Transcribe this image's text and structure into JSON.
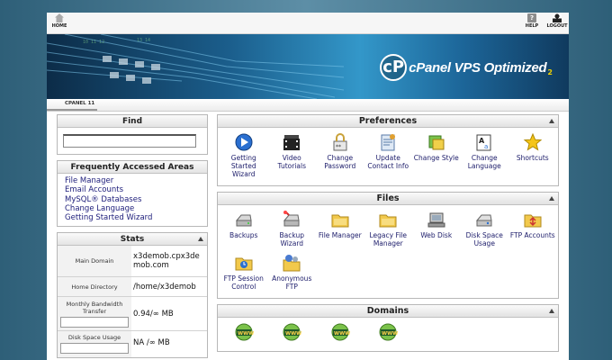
{
  "nav": {
    "home": "HOME",
    "help": "HELP",
    "logout": "LOGOUT"
  },
  "banner": {
    "logo_mark": "cP",
    "logo_text": "cPanel VPS Optimized",
    "logo_suffix": "2"
  },
  "breadcrumb": "CPANEL 11",
  "find": {
    "title": "Find",
    "value": ""
  },
  "faa": {
    "title": "Frequently Accessed Areas",
    "links": [
      "File Manager",
      "Email Accounts",
      "MySQL® Databases",
      "Change Language",
      "Getting Started Wizard"
    ]
  },
  "stats": {
    "title": "Stats",
    "rows": [
      {
        "label": "Main Domain",
        "value": "x3demob.cpx3demob.com"
      },
      {
        "label": "Home Directory",
        "value": "/home/x3demob"
      },
      {
        "label": "Monthly Bandwidth Transfer",
        "value": "0.94/∞ MB"
      },
      {
        "label": "Disk Space Usage",
        "value": "NA /∞ MB"
      }
    ]
  },
  "preferences": {
    "title": "Preferences",
    "items": [
      "Getting Started Wizard",
      "Video Tutorials",
      "Change Password",
      "Update Contact Info",
      "Change Style",
      "Change Language",
      "Shortcuts"
    ]
  },
  "files": {
    "title": "Files",
    "items": [
      "Backups",
      "Backup Wizard",
      "File Manager",
      "Legacy File Manager",
      "Web Disk",
      "Disk Space Usage",
      "FTP Accounts",
      "FTP Session Control",
      "Anonymous FTP"
    ]
  },
  "domains": {
    "title": "Domains",
    "items": [
      "",
      "",
      "",
      ""
    ]
  },
  "colors": {
    "link": "#1c1c7a",
    "background": "#3d6f88",
    "banner": "#1b5e8c"
  },
  "icons": {
    "preferences": [
      "wizard-icon",
      "video-icon",
      "password-icon",
      "contact-icon",
      "style-icon",
      "language-icon",
      "star-icon"
    ],
    "files": [
      "drive-icon",
      "backup-wizard-icon",
      "folder-icon",
      "folder-icon",
      "web-disk-icon",
      "disk-icon",
      "ftp-icon",
      "ftp-session-icon",
      "anonymous-ftp-icon"
    ],
    "domains": [
      "www-icon",
      "www-icon",
      "www-icon",
      "www-icon"
    ]
  }
}
